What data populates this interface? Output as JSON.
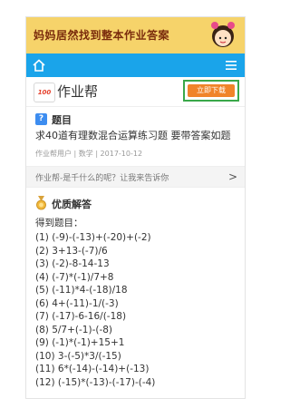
{
  "banner": {
    "text": "妈妈居然找到整本作业答案"
  },
  "app": {
    "brand": "作业帮",
    "logo_text": "100",
    "download_label": "立即下载"
  },
  "question": {
    "badge": "?",
    "heading": "题目",
    "text": "求40道有理数混合运算练习题 要带答案如题",
    "meta": "作业帮用户 | 数学 | 2017-10-12"
  },
  "related": {
    "text": "作业帮-是千什么的呢？让我来告诉你",
    "chevron": ">"
  },
  "answer": {
    "heading": "优质解答",
    "intro": "得到题目：",
    "items": [
      "(1) (-9)-(-13)+(-20)+(-2)",
      "(2) 3+13-(-7)/6",
      "(3) (-2)-8-14-13",
      "(4) (-7)*(-1)/7+8",
      "(5) (-11)*4-(-18)/18",
      "(6) 4+(-11)-1/(-3)",
      "(7) (-17)-6-16/(-18)",
      "(8) 5/7+(-1)-(-8)",
      "(9) (-1)*(-1)+15+1",
      "(10) 3-(-5)*3/(-15)",
      "(11) 6*(-14)-(-14)+(-13)",
      "(12) (-15)*(-13)-(-17)-(-4)"
    ]
  },
  "colors": {
    "nav": "#1aa4ea",
    "download": "#f0842a",
    "highlight": "#3aa84a",
    "banner": "#f6d36a"
  }
}
